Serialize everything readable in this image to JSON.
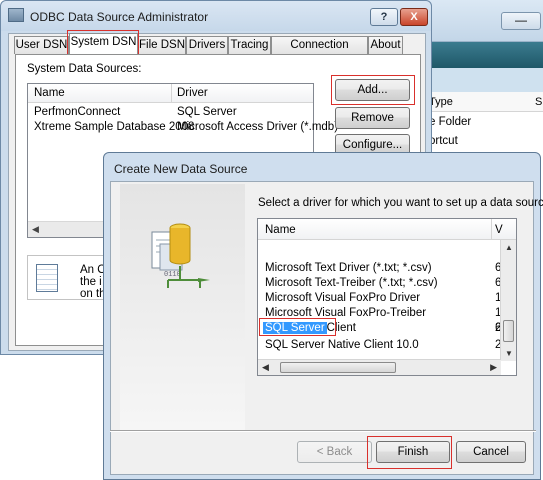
{
  "background_window": {
    "minimize_glyph": "—",
    "column_type": "Type",
    "column_size": "Si",
    "rows": [
      "e Folder",
      "ortcut"
    ]
  },
  "odbc": {
    "title": "ODBC Data Source Administrator",
    "help_glyph": "?",
    "close_glyph": "X",
    "tabs": [
      "User DSN",
      "System DSN",
      "File DSN",
      "Drivers",
      "Tracing",
      "Connection Pooling",
      "About"
    ],
    "active_tab": "System DSN",
    "list_label": "System Data Sources:",
    "columns": {
      "name": "Name",
      "driver": "Driver"
    },
    "rows": [
      {
        "name": "PerfmonConnect",
        "driver": "SQL Server"
      },
      {
        "name": "Xtreme Sample Database 2008",
        "driver": "Microsoft Access Driver (*.mdb)"
      }
    ],
    "buttons": {
      "add": "Add...",
      "remove": "Remove",
      "configure": "Configure..."
    },
    "info_lines": [
      "An O",
      "the i",
      "on th"
    ],
    "highlight_color": "#d9302c"
  },
  "dialog": {
    "title": "Create New Data Source",
    "prompt": "Select a driver for which you want to set up a data source.",
    "columns": {
      "name": "Name",
      "version": "V"
    },
    "drivers": [
      {
        "name": "Microsoft Text Driver (*.txt; *.csv)",
        "version": "6"
      },
      {
        "name": "Microsoft Text-Treiber (*.txt; *.csv)",
        "version": "6"
      },
      {
        "name": "Microsoft Visual FoxPro Driver",
        "version": "1"
      },
      {
        "name": "Microsoft Visual FoxPro-Treiber",
        "version": "1"
      },
      {
        "name": "SQL Native Client",
        "version": "2"
      },
      {
        "name": "SQL Server",
        "version": "6"
      },
      {
        "name": "SQL Server Native Client 10.0",
        "version": "2"
      }
    ],
    "selected_driver": "SQL Server",
    "buttons": {
      "back": "< Back",
      "finish": "Finish",
      "cancel": "Cancel"
    },
    "selection_color": "#3399ff"
  }
}
